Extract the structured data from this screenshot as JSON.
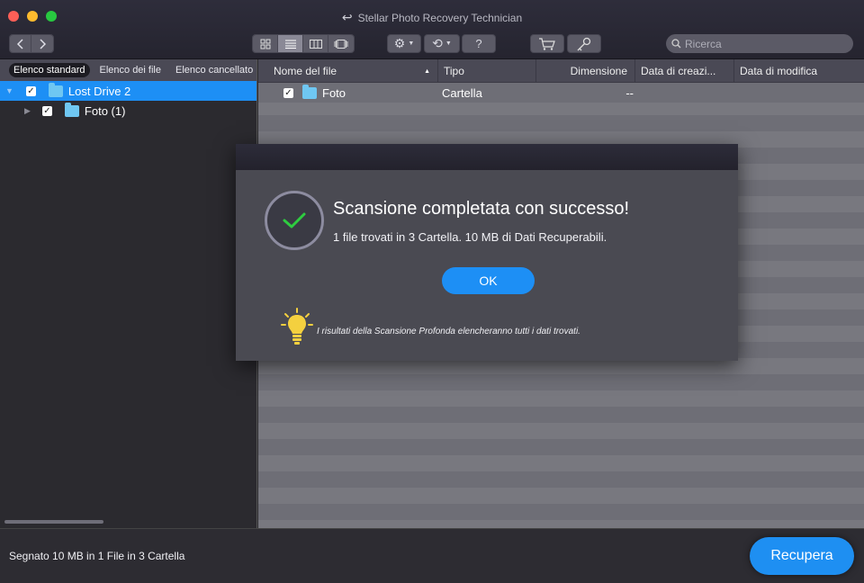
{
  "window": {
    "title": "Stellar Photo Recovery Technician"
  },
  "toolbar": {
    "search_placeholder": "Ricerca",
    "help_label": "?"
  },
  "sidebar": {
    "tabs": [
      {
        "label": "Elenco standard",
        "active": true
      },
      {
        "label": "Elenco dei file",
        "active": false
      },
      {
        "label": "Elenco cancellato",
        "active": false
      }
    ],
    "tree": [
      {
        "label": "Lost Drive 2",
        "checked": true,
        "selected": true
      },
      {
        "label": "Foto (1)",
        "checked": true,
        "selected": false
      }
    ]
  },
  "file_list": {
    "columns": [
      "Nome del file",
      "Tipo",
      "Dimensione",
      "Data di creazi...",
      "Data di modifica"
    ],
    "rows": [
      {
        "name": "Foto",
        "type": "Cartella",
        "size": "--",
        "created": "",
        "modified": "",
        "checked": true
      }
    ]
  },
  "status": {
    "text": "Segnato 10  MB in 1 File in 3 Cartella",
    "recover_label": "Recupera"
  },
  "dialog": {
    "title": "Scansione completata con successo!",
    "message": "1 file trovati in 3 Cartella. 10  MB di Dati Recuperabili.",
    "ok_label": "OK",
    "tip": "I risultati della Scansione Profonda elencheranno tutti i dati trovati."
  },
  "colors": {
    "accent": "#1d8ff5",
    "folder": "#6fc7f2",
    "success_check": "#2ecc40",
    "tip_bulb": "#f4d03f"
  }
}
